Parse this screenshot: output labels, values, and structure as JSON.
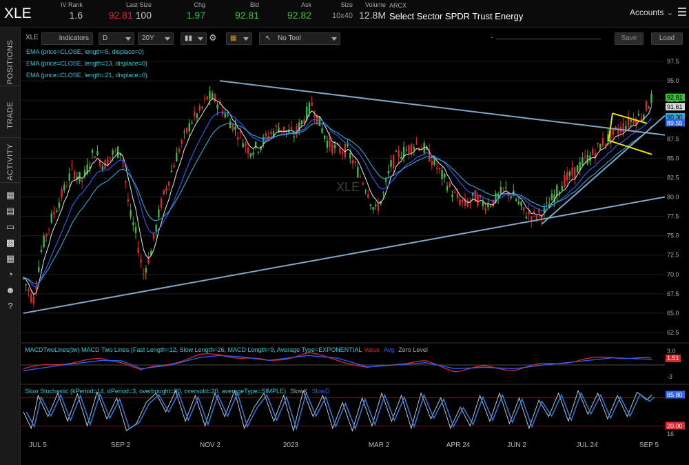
{
  "header": {
    "symbol": "XLE",
    "iv_rank": {
      "label": "IV Rank",
      "value": "1.6"
    },
    "last_size": {
      "label": "Last Size",
      "last": "92.81",
      "size": "100"
    },
    "chg": {
      "label": "Chg",
      "value": "1.97"
    },
    "bid": {
      "label": "Bid",
      "value": "92.81"
    },
    "ask": {
      "label": "Ask",
      "value": "92.82"
    },
    "size": {
      "label": "Size",
      "value": "10x40"
    },
    "volume": {
      "label": "Volume",
      "value": "12.8M"
    },
    "exchange": "ARCX",
    "name": "Select Sector SPDR Trust Energy",
    "accounts": "Accounts"
  },
  "side_tabs": [
    "POSITIONS",
    "TRADE",
    "ACTIVITY"
  ],
  "side_icons": [
    "calendar-icon",
    "news-icon",
    "tv-icon",
    "chart-icon",
    "grid-icon",
    "gauge-icon",
    "people-icon",
    "help-icon"
  ],
  "toolbar": {
    "symbol": "XLE",
    "indicators": "Indicators",
    "aggregation": "D",
    "range": "20Y",
    "tool": "No Tool",
    "zoom": "-",
    "save": "Save",
    "load": "Load"
  },
  "studies": {
    "ema5": "EMA (price=CLOSE, length=5, displace=0)",
    "ema13": "EMA (price=CLOSE, length=13, displace=0)",
    "ema21": "EMA (price=CLOSE, length=21, displace=0)",
    "macd": "MACDTwoLines(tw) MACD Two Lines (Fast Length=12, Slow Length=26, MACD Length=9, Average Type=EXPONENTIAL",
    "macd_value": "Value",
    "macd_avg": "Avg",
    "macd_zero": "Zero Level",
    "stoch": "Slow Stochastic (kPeriod=14, dPeriod=3, overbought=80, oversold=20, averageType=SIMPLE)",
    "stoch_k": "SlowK",
    "stoch_d": "SlowD"
  },
  "watermark": "XLE",
  "colors": {
    "up": "#3cbd3c",
    "down": "#e0262b",
    "ema5": "#d9d9d9",
    "ema13": "#2c63ff",
    "ema21": "#30a9d6",
    "trend": "#7ea8c6",
    "flag": "#e6e600",
    "study_text": "#37c8d4"
  },
  "chart_data": {
    "type": "candlestick",
    "price_axis": {
      "min": 62.5,
      "max": 97.5,
      "ticks": [
        "97.5",
        "95.0",
        "92.5",
        "90.0",
        "87.5",
        "85.0",
        "82.5",
        "80.0",
        "77.5",
        "75.0",
        "72.5",
        "70.0",
        "67.5",
        "65.0",
        "62.5"
      ]
    },
    "price_badges": [
      {
        "value": "92.81",
        "bg": "#3cbd3c",
        "fg": "#000"
      },
      {
        "value": "91.61",
        "bg": "#d9d9d9",
        "fg": "#000"
      },
      {
        "value": "90.30",
        "bg": "#30a9d6",
        "fg": "#000"
      },
      {
        "value": "89.55",
        "bg": "#2c63ff",
        "fg": "#fff"
      }
    ],
    "x_labels": [
      "JUL 5",
      "SEP 2",
      "NOV 2",
      "2023",
      "MAR 2",
      "APR 24",
      "JUN 2",
      "JUL 24",
      "SEP 5"
    ],
    "close_path": [
      [
        0,
        69.5
      ],
      [
        10,
        66.5
      ],
      [
        18,
        73
      ],
      [
        28,
        77
      ],
      [
        40,
        80.5
      ],
      [
        50,
        83.5
      ],
      [
        60,
        82
      ],
      [
        72,
        86
      ],
      [
        82,
        84
      ],
      [
        90,
        85.5
      ],
      [
        100,
        86
      ],
      [
        108,
        78
      ],
      [
        115,
        75
      ],
      [
        122,
        70
      ],
      [
        130,
        73
      ],
      [
        140,
        79
      ],
      [
        150,
        83
      ],
      [
        158,
        86
      ],
      [
        165,
        88
      ],
      [
        172,
        90
      ],
      [
        180,
        91
      ],
      [
        188,
        93
      ],
      [
        196,
        92.5
      ],
      [
        204,
        91
      ],
      [
        212,
        89.5
      ],
      [
        220,
        88
      ],
      [
        230,
        86
      ],
      [
        240,
        86.5
      ],
      [
        250,
        88
      ],
      [
        260,
        89
      ],
      [
        268,
        88.5
      ],
      [
        276,
        88
      ],
      [
        285,
        90
      ],
      [
        294,
        92
      ],
      [
        300,
        90
      ],
      [
        310,
        87
      ],
      [
        320,
        86
      ],
      [
        330,
        86
      ],
      [
        340,
        83.5
      ],
      [
        350,
        81
      ],
      [
        358,
        78
      ],
      [
        366,
        80
      ],
      [
        374,
        84
      ],
      [
        382,
        85.5
      ],
      [
        390,
        86
      ],
      [
        400,
        87
      ],
      [
        410,
        86
      ],
      [
        420,
        84
      ],
      [
        430,
        82
      ],
      [
        440,
        80
      ],
      [
        450,
        79
      ],
      [
        460,
        80
      ],
      [
        470,
        79
      ],
      [
        480,
        79.5
      ],
      [
        490,
        81
      ],
      [
        500,
        80
      ],
      [
        510,
        78
      ],
      [
        520,
        77.5
      ],
      [
        530,
        78
      ],
      [
        540,
        80
      ],
      [
        550,
        82
      ],
      [
        560,
        83
      ],
      [
        570,
        84.5
      ],
      [
        580,
        85.5
      ],
      [
        590,
        87
      ],
      [
        600,
        88
      ],
      [
        610,
        89
      ],
      [
        620,
        90
      ],
      [
        630,
        90.5
      ],
      [
        640,
        92.8
      ]
    ],
    "macd_axis": {
      "ticks": [
        "3.0",
        "1.51",
        "-3"
      ],
      "zero": 0
    },
    "macd_value": [
      [
        0,
        -1
      ],
      [
        40,
        0.5
      ],
      [
        80,
        1.5
      ],
      [
        100,
        1
      ],
      [
        120,
        -1.5
      ],
      [
        150,
        0.5
      ],
      [
        180,
        2.5
      ],
      [
        200,
        2.8
      ],
      [
        220,
        2
      ],
      [
        250,
        1
      ],
      [
        290,
        3
      ],
      [
        320,
        1.5
      ],
      [
        350,
        -1
      ],
      [
        380,
        0.5
      ],
      [
        410,
        0.8
      ],
      [
        440,
        -1.5
      ],
      [
        470,
        -0.5
      ],
      [
        500,
        -1.2
      ],
      [
        530,
        0.2
      ],
      [
        560,
        1
      ],
      [
        600,
        2.2
      ],
      [
        640,
        1.5
      ]
    ],
    "macd_avg": [
      [
        0,
        -1.5
      ],
      [
        40,
        0
      ],
      [
        80,
        1.2
      ],
      [
        100,
        1.1
      ],
      [
        120,
        -1
      ],
      [
        150,
        0
      ],
      [
        180,
        2
      ],
      [
        200,
        2.5
      ],
      [
        220,
        2.2
      ],
      [
        250,
        1.2
      ],
      [
        290,
        2.5
      ],
      [
        320,
        1.8
      ],
      [
        350,
        -0.5
      ],
      [
        380,
        0
      ],
      [
        410,
        0.6
      ],
      [
        440,
        -1
      ],
      [
        470,
        -0.6
      ],
      [
        500,
        -1
      ],
      [
        530,
        0
      ],
      [
        560,
        0.8
      ],
      [
        600,
        1.9
      ],
      [
        640,
        1.5
      ]
    ],
    "stoch_axis": {
      "overbought": 80,
      "oversold": 20,
      "badges": [
        "85.80",
        "20.00"
      ],
      "tick_low": "16"
    },
    "stoch_k": [
      [
        0,
        50
      ],
      [
        8,
        15
      ],
      [
        15,
        85
      ],
      [
        25,
        40
      ],
      [
        35,
        90
      ],
      [
        45,
        30
      ],
      [
        55,
        88
      ],
      [
        65,
        20
      ],
      [
        75,
        92
      ],
      [
        85,
        35
      ],
      [
        95,
        80
      ],
      [
        105,
        10
      ],
      [
        115,
        25
      ],
      [
        125,
        70
      ],
      [
        135,
        90
      ],
      [
        145,
        50
      ],
      [
        155,
        95
      ],
      [
        165,
        30
      ],
      [
        175,
        85
      ],
      [
        185,
        20
      ],
      [
        195,
        90
      ],
      [
        205,
        40
      ],
      [
        215,
        95
      ],
      [
        225,
        15
      ],
      [
        235,
        60
      ],
      [
        245,
        90
      ],
      [
        255,
        30
      ],
      [
        265,
        85
      ],
      [
        275,
        10
      ],
      [
        285,
        95
      ],
      [
        295,
        40
      ],
      [
        305,
        85
      ],
      [
        315,
        15
      ],
      [
        325,
        70
      ],
      [
        335,
        10
      ],
      [
        345,
        80
      ],
      [
        355,
        20
      ],
      [
        365,
        90
      ],
      [
        375,
        30
      ],
      [
        385,
        85
      ],
      [
        395,
        15
      ],
      [
        405,
        90
      ],
      [
        415,
        35
      ],
      [
        425,
        80
      ],
      [
        435,
        15
      ],
      [
        445,
        60
      ],
      [
        455,
        20
      ],
      [
        465,
        85
      ],
      [
        475,
        30
      ],
      [
        485,
        90
      ],
      [
        495,
        25
      ],
      [
        505,
        80
      ],
      [
        515,
        15
      ],
      [
        525,
        75
      ],
      [
        535,
        40
      ],
      [
        545,
        90
      ],
      [
        555,
        30
      ],
      [
        565,
        95
      ],
      [
        575,
        45
      ],
      [
        585,
        90
      ],
      [
        595,
        35
      ],
      [
        605,
        85
      ],
      [
        615,
        40
      ],
      [
        625,
        92
      ],
      [
        635,
        75
      ],
      [
        640,
        86
      ]
    ]
  }
}
